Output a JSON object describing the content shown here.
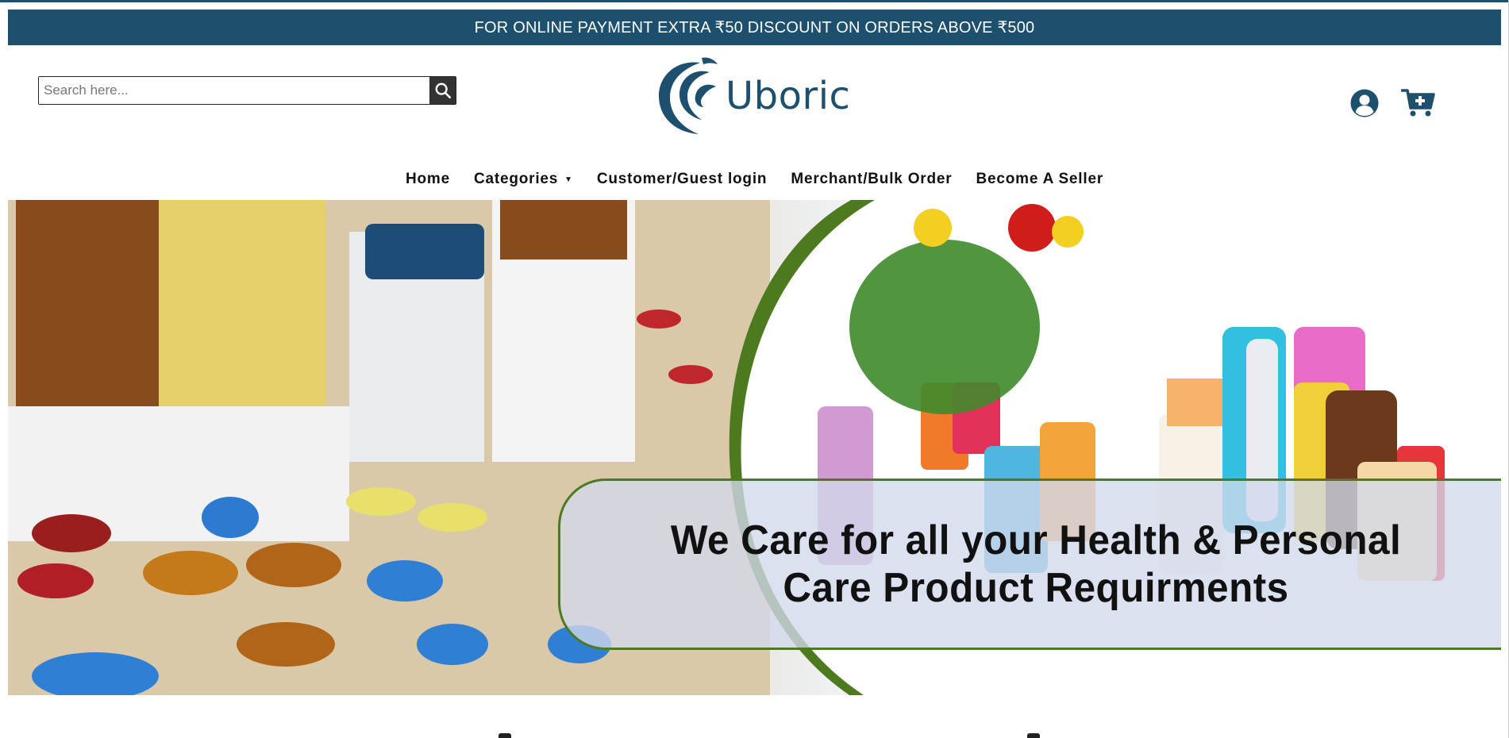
{
  "announcement": "FOR ONLINE PAYMENT EXTRA ₹50 DISCOUNT ON ORDERS ABOVE ₹500",
  "search": {
    "placeholder": "Search here..."
  },
  "logo": {
    "text": "Uboric"
  },
  "header_icons": [
    "user-circle-icon",
    "cart-plus-icon"
  ],
  "nav": {
    "home": "Home",
    "categories": "Categories",
    "customer_login": "Customer/Guest login",
    "merchant": "Merchant/Bulk Order",
    "seller": "Become A Seller"
  },
  "hero": {
    "caption": "We Care for all your Health & Personal Care Product Requirments"
  },
  "colors": {
    "brand": "#1d4f6e",
    "hero_arc": "#4e7a1f"
  }
}
